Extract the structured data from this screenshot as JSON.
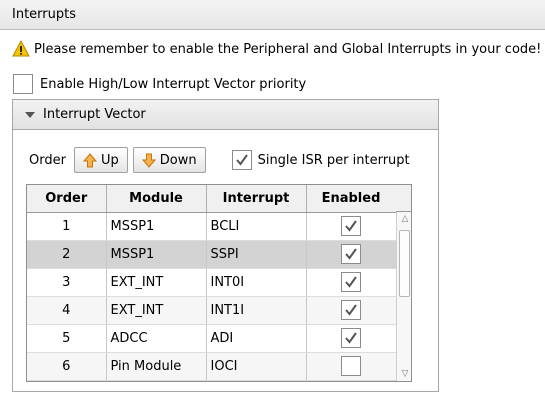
{
  "window": {
    "title": "Interrupts"
  },
  "warning": {
    "icon": "warning-icon",
    "text": "Please remember to enable the Peripheral and Global Interrupts in your code!"
  },
  "priority": {
    "label": "Enable High/Low Interrupt Vector priority",
    "checked": false
  },
  "vector_panel": {
    "title": "Interrupt Vector",
    "expanded": true
  },
  "toolbar": {
    "order_label": "Order",
    "up_label": "Up",
    "down_label": "Down",
    "single_isr_label": "Single ISR per interrupt",
    "single_isr_checked": true
  },
  "table": {
    "columns": [
      "Order",
      "Module",
      "Interrupt",
      "Enabled"
    ],
    "rows": [
      {
        "order": "1",
        "module": "MSSP1",
        "interrupt": "BCLI",
        "enabled": true
      },
      {
        "order": "2",
        "module": "MSSP1",
        "interrupt": "SSPI",
        "enabled": true,
        "selected": true
      },
      {
        "order": "3",
        "module": "EXT_INT",
        "interrupt": "INT0I",
        "enabled": true
      },
      {
        "order": "4",
        "module": "EXT_INT",
        "interrupt": "INT1I",
        "enabled": true
      },
      {
        "order": "5",
        "module": "ADCC",
        "interrupt": "ADI",
        "enabled": true
      },
      {
        "order": "6",
        "module": "Pin Module",
        "interrupt": "IOCI",
        "enabled": false
      }
    ]
  },
  "colors": {
    "selected_row": "#d3d3d3",
    "warning_yellow": "#f5c400",
    "arrow_orange": "#e08a1e"
  }
}
